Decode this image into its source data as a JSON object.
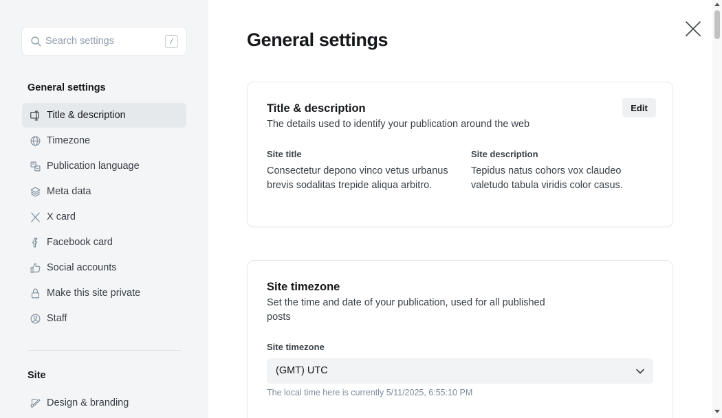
{
  "search": {
    "placeholder": "Search settings",
    "shortcut": "/"
  },
  "sidebar": {
    "groups": [
      {
        "title": "General settings",
        "items": [
          {
            "label": "Title & description",
            "icon": "title-description-icon",
            "active": true
          },
          {
            "label": "Timezone",
            "icon": "globe-icon"
          },
          {
            "label": "Publication language",
            "icon": "translate-icon"
          },
          {
            "label": "Meta data",
            "icon": "layers-icon"
          },
          {
            "label": "X card",
            "icon": "x-logo-icon"
          },
          {
            "label": "Facebook card",
            "icon": "facebook-icon"
          },
          {
            "label": "Social accounts",
            "icon": "thumbs-up-icon"
          },
          {
            "label": "Make this site private",
            "icon": "lock-icon"
          },
          {
            "label": "Staff",
            "icon": "users-icon"
          }
        ]
      },
      {
        "title": "Site",
        "items": [
          {
            "label": "Design & branding",
            "icon": "paint-brush-icon"
          }
        ]
      }
    ]
  },
  "main": {
    "title": "General settings",
    "cards": {
      "title_description": {
        "title": "Title & description",
        "description": "The details used to identify your publication around the web",
        "edit_label": "Edit",
        "fields": [
          {
            "label": "Site title",
            "value": "Consectetur depono vinco vetus urbanus brevis sodalitas trepide aliqua arbitro."
          },
          {
            "label": "Site description",
            "value": "Tepidus natus cohors vox claudeo valetudo tabula viridis color casus."
          }
        ]
      },
      "timezone": {
        "title": "Site timezone",
        "description": "Set the time and date of your publication, used for all published posts",
        "field_label": "Site timezone",
        "selected": "(GMT) UTC",
        "hint": "The local time here is currently 5/11/2025, 6:55:10 PM"
      }
    }
  },
  "colors": {
    "sidebar_bg": "#f4f5f6",
    "active_item_bg": "#e6e9eb",
    "text_primary": "#15171a",
    "text_secondary": "#394047",
    "hint_text": "#7c8b9a"
  }
}
